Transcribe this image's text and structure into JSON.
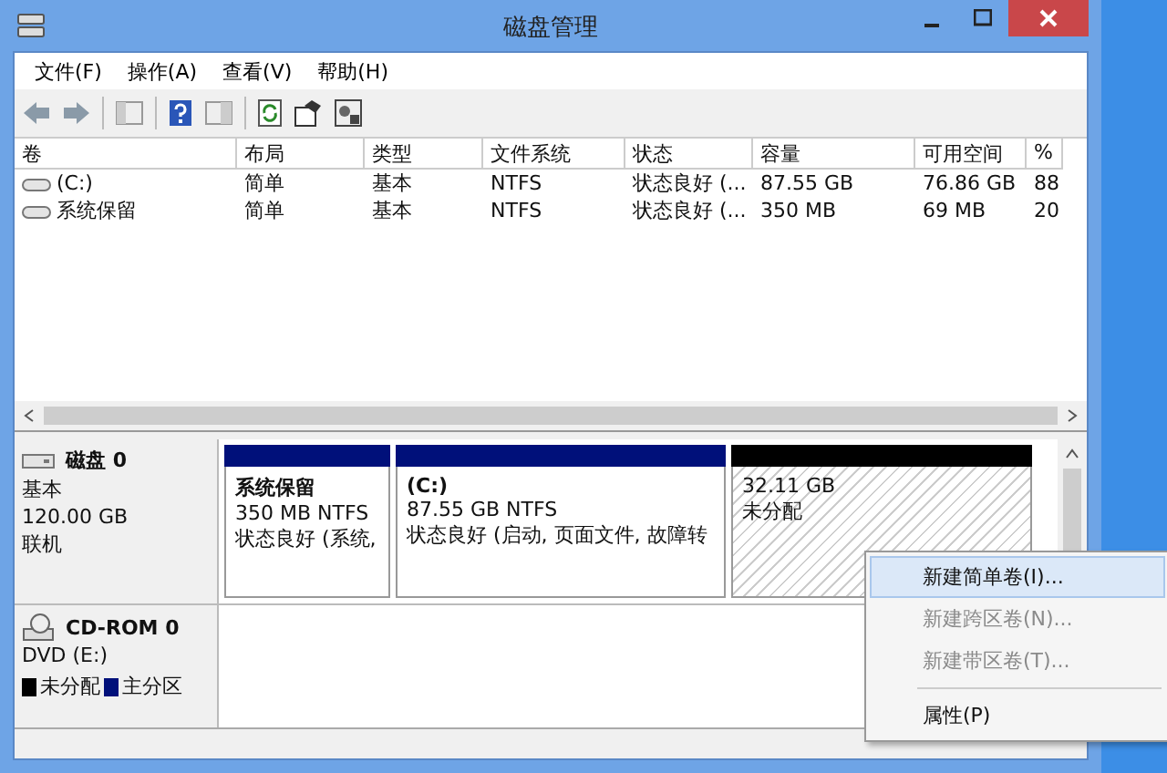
{
  "window": {
    "title": "磁盘管理"
  },
  "menu": [
    "文件(F)",
    "操作(A)",
    "查看(V)",
    "帮助(H)"
  ],
  "table": {
    "columns": [
      "卷",
      "布局",
      "类型",
      "文件系统",
      "状态",
      "容量",
      "可用空间",
      "%"
    ],
    "rows": [
      [
        "(C:)",
        "简单",
        "基本",
        "NTFS",
        "状态良好 (...",
        "87.55 GB",
        "76.86 GB",
        "88"
      ],
      [
        "系统保留",
        "简单",
        "基本",
        "NTFS",
        "状态良好 (...",
        "350 MB",
        "69 MB",
        "20"
      ]
    ]
  },
  "disks": [
    {
      "kind": "disk",
      "name": "磁盘 0",
      "lines": [
        "基本",
        "120.00 GB",
        "联机"
      ],
      "partitions": [
        {
          "kind": "primary",
          "title": "系统保留",
          "size": "350 MB NTFS",
          "status": "状态良好 (系统,"
        },
        {
          "kind": "primary",
          "title": "(C:)",
          "size": "87.55 GB NTFS",
          "status": "状态良好 (启动, 页面文件, 故障转"
        },
        {
          "kind": "unallocated",
          "size": "32.11 GB",
          "status": "未分配"
        }
      ]
    },
    {
      "kind": "cdrom",
      "name": "CD-ROM 0",
      "lines": [
        "DVD (E:)"
      ]
    }
  ],
  "legend": [
    {
      "label": "未分配",
      "color": "#000000"
    },
    {
      "label": "主分区",
      "color": "#00107a"
    }
  ],
  "context_menu": [
    {
      "label": "新建简单卷(I)...",
      "selected": true,
      "disabled": false
    },
    {
      "label": "新建跨区卷(N)...",
      "selected": false,
      "disabled": true
    },
    {
      "label": "新建带区卷(T)...",
      "selected": false,
      "disabled": true
    },
    {
      "kind": "separator"
    },
    {
      "label": "属性(P)",
      "selected": false,
      "disabled": false
    }
  ]
}
